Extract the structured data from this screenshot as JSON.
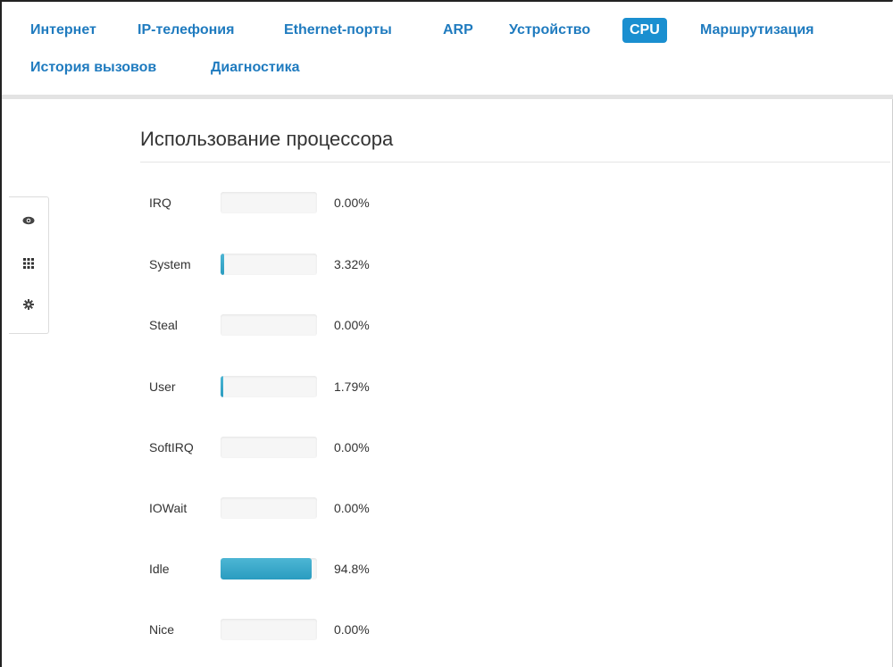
{
  "nav": {
    "tabs": [
      {
        "label": "Интернет"
      },
      {
        "label": "IP-телефония"
      },
      {
        "label": "Ethernet-порты"
      },
      {
        "label": "ARP"
      },
      {
        "label": "Устройство"
      },
      {
        "label": "CPU"
      },
      {
        "label": "Маршрутизация"
      },
      {
        "label": "История вызовов"
      },
      {
        "label": "Диагностика"
      }
    ],
    "active_tab": "CPU",
    "accent_color": "#1a8fd0"
  },
  "toolbar": {
    "icons": [
      "eye-icon",
      "grid-icon",
      "gear-icon"
    ]
  },
  "page": {
    "title": "Использование процессора"
  },
  "cpu": {
    "rows": [
      {
        "label": "IRQ",
        "value": "0.00%",
        "fraction": 0.0
      },
      {
        "label": "System",
        "value": "3.32%",
        "fraction": 0.0332
      },
      {
        "label": "Steal",
        "value": "0.00%",
        "fraction": 0.0
      },
      {
        "label": "User",
        "value": "1.79%",
        "fraction": 0.0179
      },
      {
        "label": "SoftIRQ",
        "value": "0.00%",
        "fraction": 0.0
      },
      {
        "label": "IOWait",
        "value": "0.00%",
        "fraction": 0.0
      },
      {
        "label": "Idle",
        "value": "94.8%",
        "fraction": 0.948
      },
      {
        "label": "Nice",
        "value": "0.00%",
        "fraction": 0.0
      }
    ],
    "bar_color": "#2a9cc0"
  }
}
